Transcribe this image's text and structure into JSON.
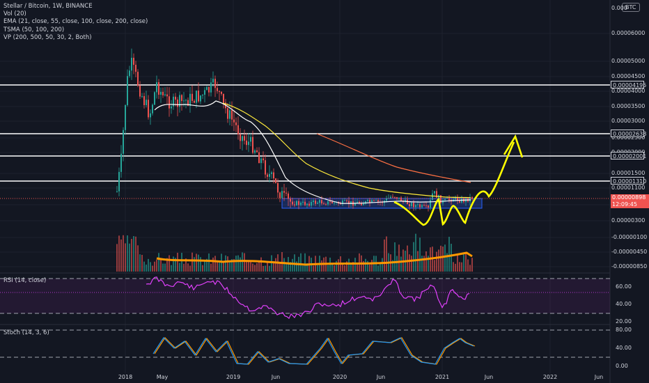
{
  "legend": {
    "title": "Stellar / Bitcoin, 1W, BINANCE",
    "vol": "Vol (20)",
    "ema": "EMA (21, close, 55, close, 100, close, 200, close)",
    "tsma": "TSMA (50, 100, 200)",
    "vp": "VP (200, 500, 50, 30, 2, Both)"
  },
  "currency_badge": "BTC",
  "price_axis": {
    "top_label": "0.000",
    "labels": [
      "0.00000600",
      "0.00000500",
      "0.00000450",
      "0.00000400",
      "0.00000350",
      "0.00000300",
      "0.00000250",
      "0.00000200",
      "0.00000150",
      "0.00000100",
      "0.00000050",
      "0.00000000",
      "-0.00000050",
      "-0.00000100",
      "-0.00000150"
    ],
    "labels_display": [
      "0.00006000",
      "0.00005000",
      "0.00004500",
      "0.00004000",
      "0.00003500",
      "0.00003000",
      "0.00002500",
      "0.00002000",
      "0.00001500",
      "0.00001100",
      "0.00000700",
      "0.00000300",
      "-0.00000100",
      "-0.00000450",
      "-0.00000850"
    ]
  },
  "horizontal_levels": [
    "0.00004195",
    "0.00002638",
    "0.00002001",
    "0.00001310"
  ],
  "current_price": {
    "value": "0.00000898",
    "countdown": "12:09:45"
  },
  "rsi": {
    "title": "RSI (14, close)",
    "labels": [
      "60.00",
      "40.00",
      "20.00"
    ]
  },
  "stoch": {
    "title": "Stoch (14, 3, 6)",
    "labels": [
      "80.00",
      "40.00",
      "0.00"
    ]
  },
  "x_axis": [
    "2018",
    "May",
    "2019",
    "Jun",
    "2020",
    "Jun",
    "2021",
    "Jun",
    "2022",
    "Jun"
  ],
  "colors": {
    "background": "#131722",
    "up": "#26a69a",
    "down": "#ef5350",
    "ema21": "#ffffff",
    "ema55": "#ffeb3b",
    "ema200": "#ff7043",
    "drawing": "#ffff00",
    "rsi": "#e040fb",
    "stoch_k": "#2196f3",
    "stoch_d": "#ff9800",
    "box": "#2962ff"
  }
}
